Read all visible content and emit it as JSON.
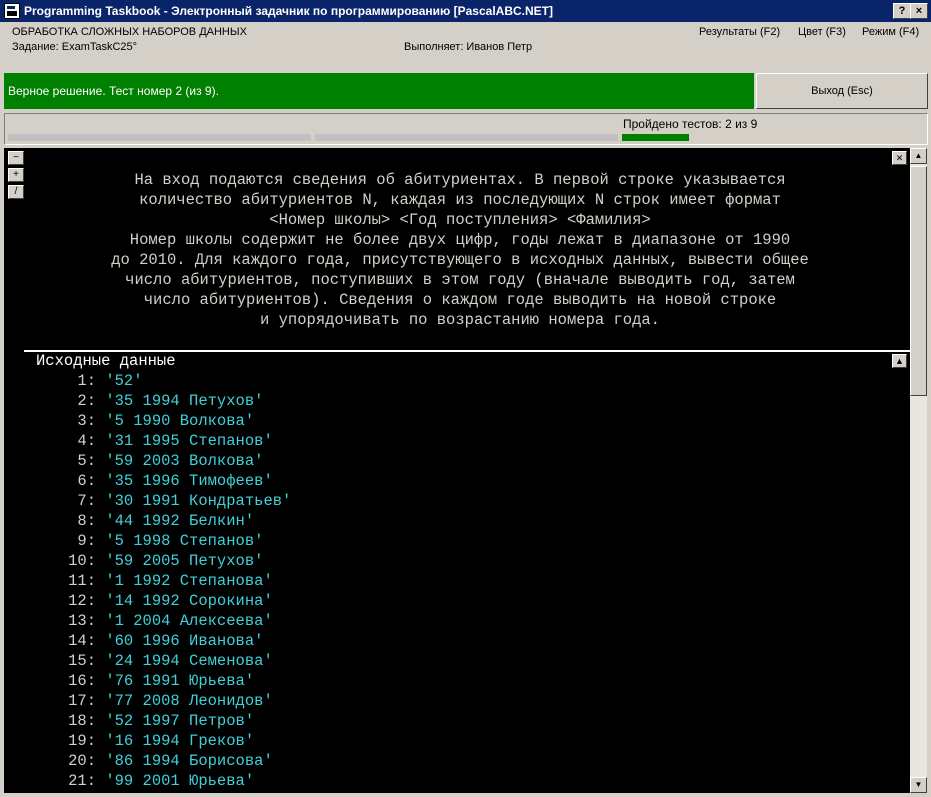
{
  "window": {
    "title": "Programming Taskbook - Электронный задачник по программированию [PascalABC.NET]",
    "help_btn": "?",
    "close_btn": "×"
  },
  "header": {
    "section": "ОБРАБОТКА СЛОЖНЫХ НАБОРОВ ДАННЫХ",
    "task": "Задание: ExamTaskC25°",
    "performer": "Выполняет: Иванов Петр",
    "menu_results": "Результаты (F2)",
    "menu_color": "Цвет (F3)",
    "menu_mode": "Режим (F4)"
  },
  "status": {
    "message": "Верное решение. Тест номер 2 (из 9).",
    "color": "#008000"
  },
  "exit_button": "Выход (Esc)",
  "progress": {
    "label": "Пройдено тестов: 2 из 9",
    "passed": 2,
    "total": 9,
    "pass_color": "#008000"
  },
  "side_buttons": {
    "minus": "−",
    "plus": "+",
    "slash": "/"
  },
  "task_text": "На вход подаются сведения об абитуриентах. В первой строке указывается\nколичество абитуриентов N, каждая из последующих N строк имеет формат\n<Номер школы> <Год поступления> <Фамилия>\nНомер школы содержит не более двух цифр, годы лежат в диапазоне от 1990\nдо 2010. Для каждого года, присутствующего в исходных данных, вывести общее\nчисло абитуриентов, поступивших в этом году (вначале выводить год, затем\nчисло абитуриентов). Сведения о каждом годе выводить на новой строке\nи упорядочивать по возрастанию номера года.",
  "input_section": {
    "title": "Исходные данные",
    "rows": [
      {
        "num": "1:",
        "value": "'52'"
      },
      {
        "num": "2:",
        "value": "'35 1994 Петухов'"
      },
      {
        "num": "3:",
        "value": "'5 1990 Волкова'"
      },
      {
        "num": "4:",
        "value": "'31 1995 Степанов'"
      },
      {
        "num": "5:",
        "value": "'59 2003 Волкова'"
      },
      {
        "num": "6:",
        "value": "'35 1996 Тимофеев'"
      },
      {
        "num": "7:",
        "value": "'30 1991 Кондратьев'"
      },
      {
        "num": "8:",
        "value": "'44 1992 Белкин'"
      },
      {
        "num": "9:",
        "value": "'5 1998 Степанов'"
      },
      {
        "num": "10:",
        "value": "'59 2005 Петухов'"
      },
      {
        "num": "11:",
        "value": "'1 1992 Степанова'"
      },
      {
        "num": "12:",
        "value": "'14 1992 Сорокина'"
      },
      {
        "num": "13:",
        "value": "'1 2004 Алексеева'"
      },
      {
        "num": "14:",
        "value": "'60 1996 Иванова'"
      },
      {
        "num": "15:",
        "value": "'24 1994 Семенова'"
      },
      {
        "num": "16:",
        "value": "'76 1991 Юрьева'"
      },
      {
        "num": "17:",
        "value": "'77 2008 Леонидов'"
      },
      {
        "num": "18:",
        "value": "'52 1997 Петров'"
      },
      {
        "num": "19:",
        "value": "'16 1994 Греков'"
      },
      {
        "num": "20:",
        "value": "'86 1994 Борисова'"
      },
      {
        "num": "21:",
        "value": "'99 2001 Юрьева'"
      }
    ]
  }
}
